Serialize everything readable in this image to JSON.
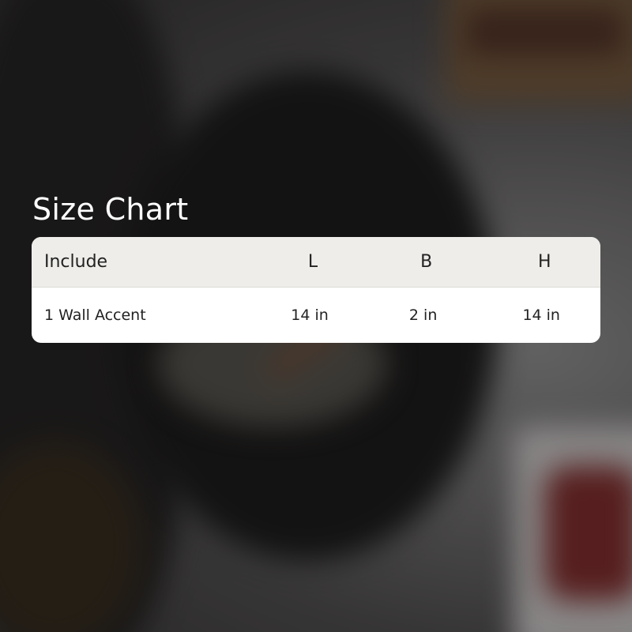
{
  "title": "Size Chart",
  "table": {
    "headers": [
      "Include",
      "L",
      "B",
      "H"
    ],
    "rows": [
      [
        "1 Wall Accent",
        "14 in",
        "2 in",
        "14 in"
      ]
    ]
  },
  "colors": {
    "header_bg": "#eeede9",
    "card_bg": "#ffffff",
    "title_text": "#ffffff",
    "cell_text": "#222222"
  }
}
